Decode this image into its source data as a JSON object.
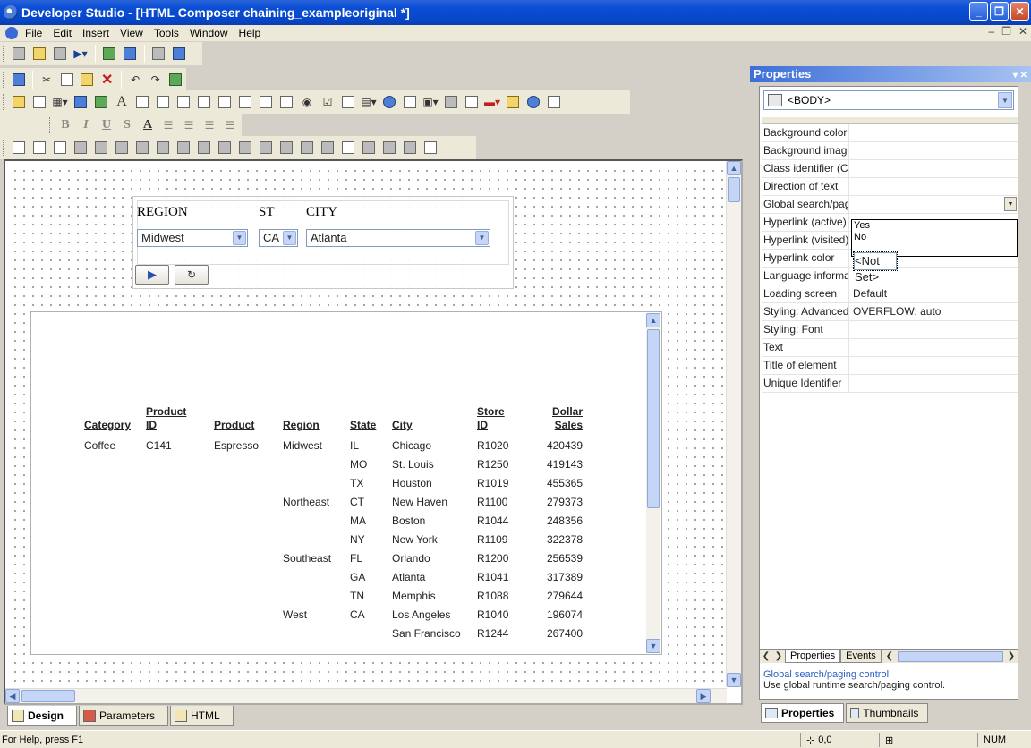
{
  "window": {
    "title": "Developer Studio - [HTML Composer chaining_exampleoriginal *]"
  },
  "menu": [
    "File",
    "Edit",
    "Insert",
    "View",
    "Tools",
    "Window",
    "Help"
  ],
  "controls": {
    "region_label": "REGION",
    "st_label": "ST",
    "city_label": "CITY",
    "region_value": "Midwest",
    "st_value": "CA",
    "city_value": "Atlanta",
    "run_icon": "play-icon",
    "reset_icon": "refresh-icon"
  },
  "report": {
    "headers": {
      "category": "Category",
      "product_id_1": "Product",
      "product_id_2": "ID",
      "product": "Product",
      "region": "Region",
      "state": "State",
      "city": "City",
      "store_id_1": "Store",
      "store_id_2": "ID",
      "sales_1": "Dollar",
      "sales_2": "Sales"
    },
    "rows": [
      {
        "category": "Coffee",
        "product_id": "C141",
        "product": "Espresso",
        "region": "Midwest",
        "state": "IL",
        "city": "Chicago",
        "store": "R1020",
        "sales": "420439"
      },
      {
        "category": "",
        "product_id": "",
        "product": "",
        "region": "",
        "state": "MO",
        "city": "St. Louis",
        "store": "R1250",
        "sales": "419143"
      },
      {
        "category": "",
        "product_id": "",
        "product": "",
        "region": "",
        "state": "TX",
        "city": "Houston",
        "store": "R1019",
        "sales": "455365"
      },
      {
        "category": "",
        "product_id": "",
        "product": "",
        "region": "Northeast",
        "state": "CT",
        "city": "New Haven",
        "store": "R1100",
        "sales": "279373"
      },
      {
        "category": "",
        "product_id": "",
        "product": "",
        "region": "",
        "state": "MA",
        "city": "Boston",
        "store": "R1044",
        "sales": "248356"
      },
      {
        "category": "",
        "product_id": "",
        "product": "",
        "region": "",
        "state": "NY",
        "city": "New York",
        "store": "R1109",
        "sales": "322378"
      },
      {
        "category": "",
        "product_id": "",
        "product": "",
        "region": "Southeast",
        "state": "FL",
        "city": "Orlando",
        "store": "R1200",
        "sales": "256539"
      },
      {
        "category": "",
        "product_id": "",
        "product": "",
        "region": "",
        "state": "GA",
        "city": "Atlanta",
        "store": "R1041",
        "sales": "317389"
      },
      {
        "category": "",
        "product_id": "",
        "product": "",
        "region": "",
        "state": "TN",
        "city": "Memphis",
        "store": "R1088",
        "sales": "279644"
      },
      {
        "category": "",
        "product_id": "",
        "product": "",
        "region": "West",
        "state": "CA",
        "city": "Los Angeles",
        "store": "R1040",
        "sales": "196074"
      },
      {
        "category": "",
        "product_id": "",
        "product": "",
        "region": "",
        "state": "",
        "city": "San Francisco",
        "store": "R1244",
        "sales": "267400"
      }
    ]
  },
  "bottom_tabs": [
    "Design",
    "Parameters",
    "HTML"
  ],
  "status": {
    "message": "For Help, press F1",
    "coords": "0,0",
    "num": "NUM"
  },
  "properties": {
    "title": "Properties",
    "element": "<BODY>",
    "rows": [
      {
        "name": "Background color",
        "value": ""
      },
      {
        "name": "Background image",
        "value": ""
      },
      {
        "name": "Class identifier (CSS",
        "value": ""
      },
      {
        "name": "Direction of text",
        "value": ""
      },
      {
        "name": "Global search/pagin",
        "value": ""
      },
      {
        "name": "Hyperlink (active) co",
        "value": ""
      },
      {
        "name": "Hyperlink (visited) co",
        "value": ""
      },
      {
        "name": "Hyperlink color",
        "value": ""
      },
      {
        "name": "Language informatic",
        "value": ""
      },
      {
        "name": "Loading screen",
        "value": "Default"
      },
      {
        "name": "Styling: Advanced (C",
        "value": "OVERFLOW: auto"
      },
      {
        "name": "Styling: Font",
        "value": ""
      },
      {
        "name": "Text",
        "value": ""
      },
      {
        "name": "Title of element",
        "value": ""
      },
      {
        "name": "Unique Identifier",
        "value": ""
      }
    ],
    "dropdown_options": [
      "<Not Set>",
      "Yes",
      "No"
    ],
    "tabs": [
      "Properties",
      "Events"
    ],
    "desc_title": "Global search/paging control",
    "desc_text": "Use global runtime search/paging control.",
    "panel_tabs": [
      "Properties",
      "Thumbnails"
    ]
  }
}
